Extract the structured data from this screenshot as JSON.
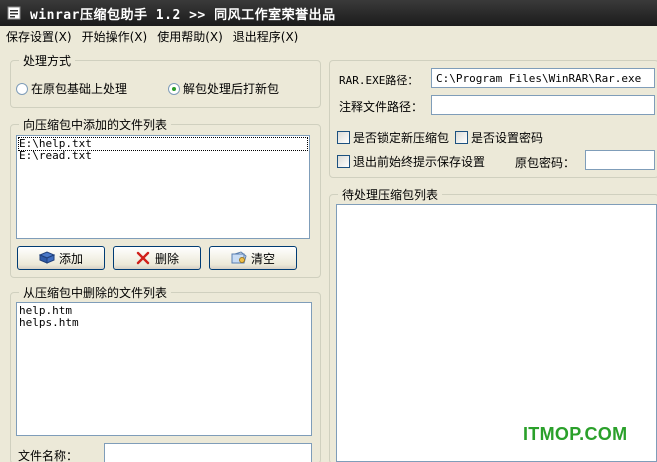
{
  "window": {
    "title": "winrar压缩包助手 1.2  >> 同风工作室荣誉出品"
  },
  "menu": {
    "items": [
      {
        "label": "保存设置(X)"
      },
      {
        "label": "开始操作(X)"
      },
      {
        "label": "使用帮助(X)"
      },
      {
        "label": "退出程序(X)"
      }
    ]
  },
  "mode": {
    "legend": "处理方式",
    "option1": "在原包基础上处理",
    "option2": "解包处理后打新包",
    "selected": "option2"
  },
  "add_list": {
    "legend": "向压缩包中添加的文件列表",
    "items": [
      "E:\\help.txt",
      "E:\\read.txt"
    ]
  },
  "buttons": {
    "add": "添加",
    "delete": "删除",
    "clear": "清空"
  },
  "remove_list": {
    "legend": "从压缩包中删除的文件列表",
    "items": [
      "help.htm",
      "helps.htm"
    ]
  },
  "filename": {
    "label": "文件名称：",
    "value": ""
  },
  "rar_path": {
    "label": "RAR.EXE路径：",
    "value": "C:\\Program Files\\WinRAR\\Rar.exe"
  },
  "comment_path": {
    "label": "注释文件路径：",
    "value": ""
  },
  "options": {
    "lock": "是否锁定新压缩包",
    "password": "是否设置密码",
    "prompt_save": "退出前始终提示保存设置",
    "orig_password_label": "原包密码：",
    "orig_password_value": ""
  },
  "pending": {
    "legend": "待处理压缩包列表"
  },
  "watermark": "ITMOP.COM",
  "colors": {
    "titlebar": "#1b1b1b",
    "window_bg": "#ece9d8",
    "watermark": "#2aa02a"
  }
}
